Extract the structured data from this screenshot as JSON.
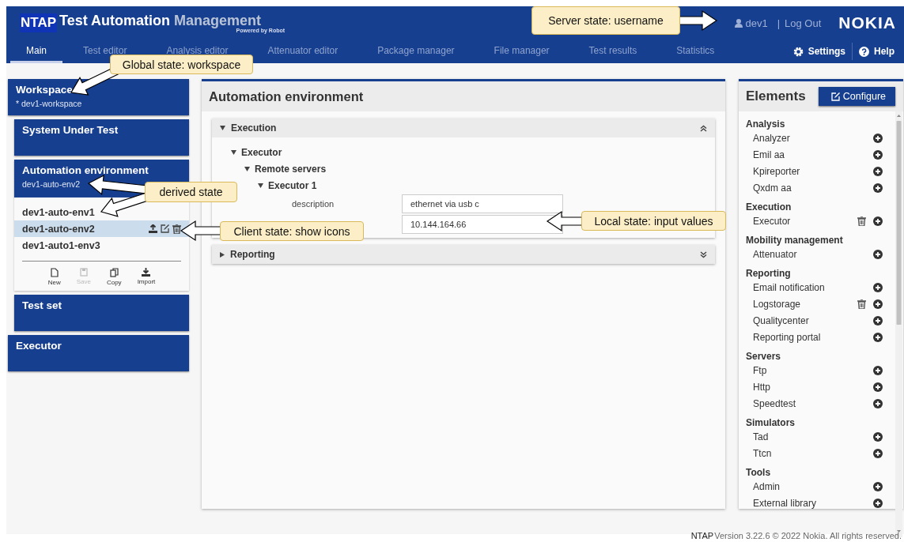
{
  "header": {
    "logo": "NTAP",
    "title": "Test Automation",
    "title_light": "Management",
    "tagline": "Powered by Robot",
    "user": "dev1",
    "separator": "|",
    "logout": "Log Out",
    "brand": "NOKIA"
  },
  "tabs": [
    {
      "label": "Main",
      "selected": true
    },
    {
      "label": "Test editor",
      "selected": false
    },
    {
      "label": "Analysis editor",
      "selected": false
    },
    {
      "label": "Attenuator editor",
      "selected": false
    },
    {
      "label": "Package manager",
      "selected": false
    },
    {
      "label": "File manager",
      "selected": false
    },
    {
      "label": "Test results",
      "selected": false
    },
    {
      "label": "Statistics",
      "selected": false
    }
  ],
  "nav_actions": [
    {
      "kind": "settings",
      "label": "Settings"
    },
    {
      "kind": "help",
      "label": "Help"
    }
  ],
  "sidebar": [
    {
      "kind": "root",
      "title": "Workspace",
      "subtitle": "* dev1-workspace"
    },
    {
      "kind": "child",
      "title": "System Under Test"
    },
    {
      "kind": "child",
      "title": "Automation environment",
      "subtitle": "dev1-auto-env2",
      "items": [
        {
          "label": "dev1-auto-env1",
          "selected": false
        },
        {
          "label": "dev1-auto-env2",
          "selected": true
        },
        {
          "label": "dev1-auto1-env3",
          "selected": false
        }
      ],
      "actions": [
        {
          "kind": "new",
          "label": "New",
          "disabled": false
        },
        {
          "kind": "save",
          "label": "Save",
          "disabled": true
        },
        {
          "kind": "copy",
          "label": "Copy",
          "disabled": false
        },
        {
          "kind": "import",
          "label": "Import",
          "disabled": false
        }
      ]
    },
    {
      "kind": "child",
      "title": "Test set"
    },
    {
      "kind": "root",
      "title": "Executor"
    }
  ],
  "panel": {
    "title": "Automation environment",
    "sections": [
      {
        "title": "Execution",
        "expanded": true,
        "tree": [
          {
            "label": "Executor",
            "expanded": true,
            "children": [
              {
                "label": "Remote servers",
                "expanded": true,
                "children": [
                  {
                    "label": "Executor 1",
                    "expanded": true,
                    "fields": [
                      {
                        "label": "description",
                        "value": "ethernet via usb c"
                      },
                      {
                        "value": "10.144.164.66"
                      }
                    ]
                  }
                ]
              }
            ]
          }
        ]
      },
      {
        "title": "Reporting",
        "expanded": false
      }
    ]
  },
  "elements": {
    "title": "Elements",
    "button": "Configure",
    "groups": [
      {
        "name": "Analysis",
        "items": [
          {
            "label": "Analyzer",
            "deletable": false
          },
          {
            "label": "Emil aa",
            "deletable": false
          },
          {
            "label": "Kpireporter",
            "deletable": false
          },
          {
            "label": "Qxdm aa",
            "deletable": false
          }
        ]
      },
      {
        "name": "Execution",
        "items": [
          {
            "label": "Executor",
            "deletable": true
          }
        ]
      },
      {
        "name": "Mobility management",
        "items": [
          {
            "label": "Attenuator",
            "deletable": false
          }
        ]
      },
      {
        "name": "Reporting",
        "items": [
          {
            "label": "Email notification",
            "deletable": false
          },
          {
            "label": "Logstorage",
            "deletable": true
          },
          {
            "label": "Qualitycenter",
            "deletable": false
          },
          {
            "label": "Reporting portal",
            "deletable": false
          }
        ]
      },
      {
        "name": "Servers",
        "items": [
          {
            "label": "Ftp",
            "deletable": false
          },
          {
            "label": "Http",
            "deletable": false
          },
          {
            "label": "Speedtest",
            "deletable": false
          }
        ]
      },
      {
        "name": "Simulators",
        "items": [
          {
            "label": "Tad",
            "deletable": false
          },
          {
            "label": "Ttcn",
            "deletable": false
          }
        ]
      },
      {
        "name": "Tools",
        "items": [
          {
            "label": "Admin",
            "deletable": false
          },
          {
            "label": "External library",
            "deletable": false
          }
        ]
      }
    ]
  },
  "footer": {
    "brand": "NTAP",
    "text": "Version 3.22.6 © 2022 Nokia. All rights reserved."
  },
  "callouts": [
    {
      "text": "Server state: username"
    },
    {
      "text": "Global state: workspace"
    },
    {
      "text": "derived state"
    },
    {
      "text": "Client state: show icons"
    },
    {
      "text": "Local state: input values"
    }
  ]
}
